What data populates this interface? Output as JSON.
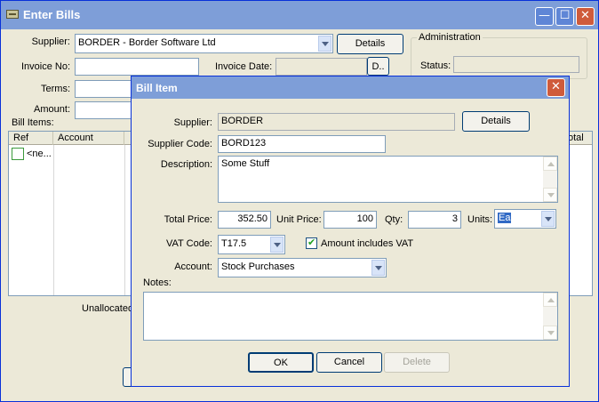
{
  "main_window": {
    "title": "Enter Bills",
    "supplier_label": "Supplier:",
    "supplier_value": "BORDER - Border Software Ltd",
    "details_button": "Details",
    "invoice_no_label": "Invoice No:",
    "invoice_no_value": "",
    "invoice_date_label": "Invoice Date:",
    "invoice_date_value": "",
    "date_picker_button": "D..",
    "terms_label": "Terms:",
    "amount_label": "Amount:",
    "administration_label": "Administration",
    "status_label": "Status:",
    "status_value": "",
    "bill_items_label": "Bill Items:",
    "columns": [
      "Ref",
      "Account",
      "",
      "otal"
    ],
    "rows": [
      {
        "ref": "<ne..."
      }
    ],
    "unallocated_label": "Unallocated"
  },
  "dialog": {
    "title": "Bill Item",
    "supplier_label": "Supplier:",
    "supplier_value": "BORDER",
    "details_button": "Details",
    "supplier_code_label": "Supplier Code:",
    "supplier_code_value": "BORD123",
    "description_label": "Description:",
    "description_value": "Some Stuff",
    "total_price_label": "Total Price:",
    "total_price_value": "352.50",
    "unit_price_label": "Unit Price:",
    "unit_price_value": "100",
    "qty_label": "Qty:",
    "qty_value": "3",
    "units_label": "Units:",
    "units_value": "Ea",
    "vat_code_label": "VAT Code:",
    "vat_code_value": "T17.5",
    "amount_includes_vat_label": "Amount includes VAT",
    "amount_includes_vat_checked": true,
    "account_label": "Account:",
    "account_value": "Stock Purchases",
    "notes_label": "Notes:",
    "notes_value": "",
    "ok_button": "OK",
    "cancel_button": "Cancel",
    "delete_button": "Delete"
  },
  "colors": {
    "titlebar_inactive": "#7e9ed8",
    "window_bg": "#ece9d8",
    "close_button": "#cf5b3b",
    "input_border": "#7f9db9",
    "selection": "#316ac5"
  }
}
